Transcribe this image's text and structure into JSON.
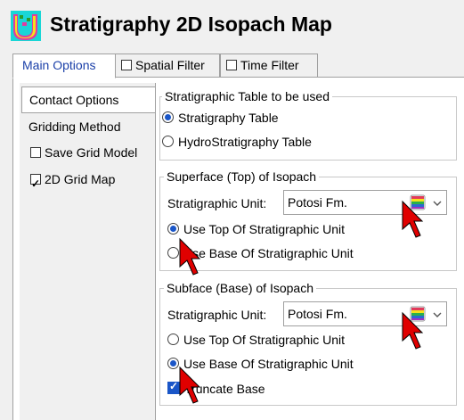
{
  "window": {
    "title": "Stratigraphy 2D Isopach Map",
    "logo_icon": "stratigraphy-logo-icon"
  },
  "tabs": [
    {
      "label": "Main Options",
      "checkbox": false,
      "selected": true
    },
    {
      "label": "Spatial Filter",
      "checkbox": true,
      "checked": false
    },
    {
      "label": "Time Filter",
      "checkbox": true,
      "checked": false
    }
  ],
  "side_nav": {
    "items": [
      {
        "label": "Contact Options",
        "selected": true
      },
      {
        "label": "Gridding Method"
      },
      {
        "label": "Save Grid Model",
        "checked": false
      },
      {
        "label": "2D Grid Map",
        "checked": true
      }
    ]
  },
  "strat_table": {
    "title": "Stratigraphic Table to be used",
    "options": [
      {
        "label": "Stratigraphy Table",
        "selected": true
      },
      {
        "label": "HydroStratigraphy Table",
        "selected": false
      }
    ]
  },
  "top_surface": {
    "title": "Superface (Top) of Isopach",
    "unit_label": "Stratigraphic Unit:",
    "unit_value": "Potosi Fm.",
    "options": [
      {
        "label": "Use Top Of Stratigraphic Unit",
        "selected": true
      },
      {
        "label": "Use Base Of Stratigraphic Unit",
        "selected": false
      }
    ]
  },
  "base_surface": {
    "title": "Subface (Base) of Isopach",
    "unit_label": "Stratigraphic Unit:",
    "unit_value": "Potosi Fm.",
    "options": [
      {
        "label": "Use Top Of Stratigraphic Unit",
        "selected": false
      },
      {
        "label": "Use Base Of Stratigraphic Unit",
        "selected": true
      }
    ],
    "truncate_label": "Truncate Base",
    "truncate_checked": true
  },
  "colors": {
    "accent": "#1a56c8",
    "tab_text": "#1a3fa8",
    "arrow": "#e00000"
  }
}
